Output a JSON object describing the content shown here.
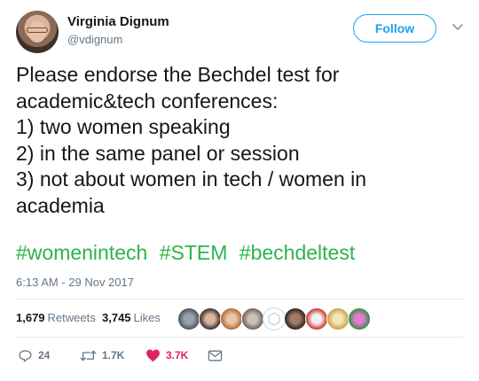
{
  "author": {
    "name": "Virginia Dignum",
    "handle": "@vdignum",
    "avatar_icon": "profile-photo"
  },
  "follow_label": "Follow",
  "tweet": {
    "lines": [
      "Please endorse the Bechdel test for",
      "academic&tech conferences:",
      "1) two women speaking",
      "2) in the same panel or session",
      "3) not about women in tech / women in",
      "academia"
    ],
    "hashtags": [
      "#womenintech",
      "#STEM",
      "#bechdeltest"
    ],
    "timestamp": "6:13 AM - 29 Nov 2017"
  },
  "stats": {
    "retweets_count": "1,679",
    "retweets_label": "Retweets",
    "likes_count": "3,745",
    "likes_label": "Likes"
  },
  "actions": {
    "reply_count": "24",
    "retweet_count": "1.7K",
    "like_count": "3.7K"
  },
  "colors": {
    "hashtag": "#2bb44a",
    "link": "#1da1f2",
    "like": "#e0245e",
    "muted": "#657786"
  }
}
